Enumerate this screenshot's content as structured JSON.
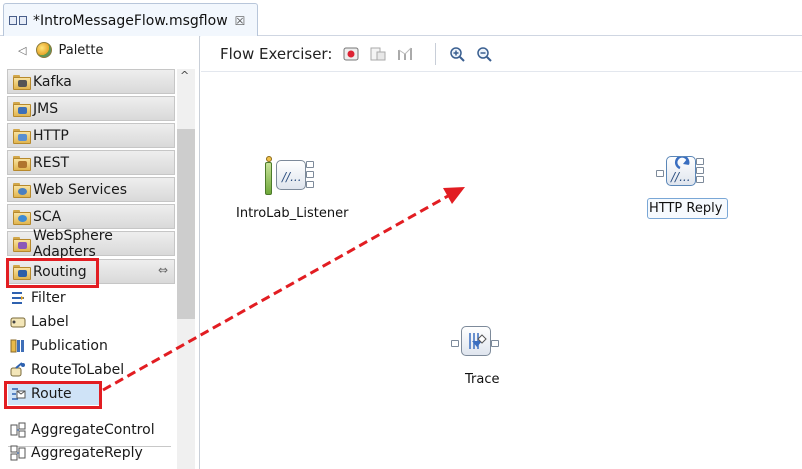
{
  "editor": {
    "tab_title": "*IntroMessageFlow.msgflow",
    "tab_close": "☒",
    "tab_icon": "msgflow-file-icon"
  },
  "palette": {
    "title": "Palette",
    "drawers": [
      {
        "label": "Kafka",
        "icon": "kafka-folder-icon"
      },
      {
        "label": "JMS",
        "icon": "jms-folder-icon"
      },
      {
        "label": "HTTP",
        "icon": "http-folder-icon"
      },
      {
        "label": "REST",
        "icon": "rest-folder-icon"
      },
      {
        "label": "Web Services",
        "icon": "web-services-folder-icon"
      },
      {
        "label": "SCA",
        "icon": "sca-folder-icon"
      },
      {
        "label": "WebSphere Adapters",
        "icon": "websphere-adapters-folder-icon"
      },
      {
        "label": "Routing",
        "icon": "routing-folder-icon"
      }
    ],
    "pin_glyph": "⇔",
    "routing_items": [
      {
        "label": "Filter",
        "icon": "filter-node-icon"
      },
      {
        "label": "Label",
        "icon": "label-node-icon"
      },
      {
        "label": "Publication",
        "icon": "publication-node-icon"
      },
      {
        "label": "RouteToLabel",
        "icon": "route-to-label-node-icon"
      },
      {
        "label": "Route",
        "icon": "route-node-icon",
        "selected": true
      }
    ],
    "aggregate_items": [
      {
        "label": "AggregateControl",
        "icon": "aggregate-control-node-icon"
      },
      {
        "label": "AggregateReply",
        "icon": "aggregate-reply-node-icon"
      }
    ]
  },
  "toolbar": {
    "flow_exerciser_label": "Flow Exerciser:",
    "buttons": [
      "record-icon",
      "send-message-icon",
      "view-path-icon",
      "zoom-in-icon",
      "zoom-out-icon"
    ]
  },
  "flow": {
    "nodes": [
      {
        "label": "IntroLab_Listener",
        "icon": "http-input-node-icon"
      },
      {
        "label": "HTTP Reply",
        "icon": "http-reply-node-icon",
        "selected": true
      },
      {
        "label": "Trace",
        "icon": "trace-node-icon"
      }
    ]
  },
  "annotations": {
    "highlight_color": "#e21d22",
    "arrow_color": "#e21d22"
  }
}
